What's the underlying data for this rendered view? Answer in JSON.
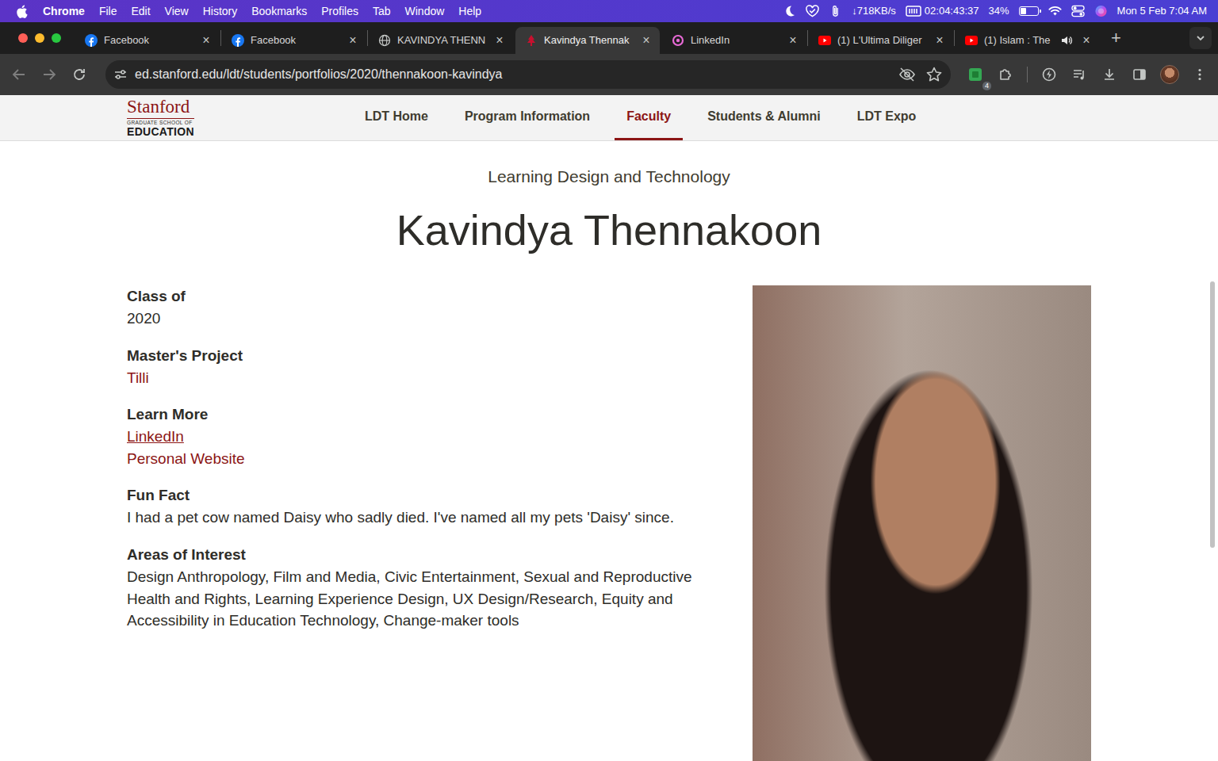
{
  "menu_bar": {
    "app": "Chrome",
    "menus": [
      "File",
      "Edit",
      "View",
      "History",
      "Bookmarks",
      "Profiles",
      "Tab",
      "Window",
      "Help"
    ],
    "network": "↓718KB/s",
    "timer": "02:04:43:37",
    "battery": {
      "reading": "34%",
      "level": 0.34
    },
    "clock": "Mon 5 Feb 7:04 AM"
  },
  "tabs": [
    {
      "label": "Facebook",
      "kind": "facebook",
      "selected": false,
      "audio": false,
      "close": "×"
    },
    {
      "label": "Facebook",
      "kind": "facebook",
      "selected": false,
      "audio": false,
      "close": "×"
    },
    {
      "label": "KAVINDYA THENN",
      "kind": "globe",
      "selected": false,
      "audio": false,
      "close": "×"
    },
    {
      "label": "Kavindya Thennak",
      "kind": "stanford",
      "selected": true,
      "audio": false,
      "close": "×"
    },
    {
      "label": "LinkedIn",
      "kind": "linkedin",
      "selected": false,
      "audio": false,
      "close": "×"
    },
    {
      "label": "(1) L'Ultima Diliger",
      "kind": "youtube",
      "selected": false,
      "audio": false,
      "close": "×"
    },
    {
      "label": "(1) Islam : The",
      "kind": "youtube",
      "selected": false,
      "audio": true,
      "close": "×"
    }
  ],
  "tab_strip": {
    "new_tab": "+"
  },
  "toolbar": {
    "nav_buttons": [
      {
        "kind": "back",
        "disabled": true
      },
      {
        "kind": "forward",
        "disabled": true
      },
      {
        "kind": "reload",
        "disabled": false
      }
    ],
    "url": "ed.stanford.edu/ldt/students/portfolios/2020/thennakoon-kavindya",
    "extension_badge": "4"
  },
  "site": {
    "logo": {
      "name": "Stanford",
      "line1": "GRADUATE SCHOOL OF",
      "line2": "EDUCATION"
    },
    "nav": [
      {
        "label": "LDT Home",
        "selected": false
      },
      {
        "label": "Program Information",
        "selected": false
      },
      {
        "label": "Faculty",
        "selected": true
      },
      {
        "label": "Students & Alumni",
        "selected": false
      },
      {
        "label": "LDT Expo",
        "selected": false
      }
    ]
  },
  "page": {
    "program": "Learning Design and Technology",
    "name": "Kavindya Thennakoon",
    "fields": [
      {
        "label": "Class of",
        "values": [
          {
            "kind": "text",
            "text": "2020"
          }
        ]
      },
      {
        "label": "Master's Project",
        "values": [
          {
            "kind": "link",
            "text": "Tilli",
            "underlined": false
          }
        ]
      },
      {
        "label": "Learn More",
        "values": [
          {
            "kind": "link",
            "text": "LinkedIn",
            "underlined": true
          },
          {
            "kind": "link",
            "text": "Personal Website",
            "underlined": false
          }
        ]
      },
      {
        "label": "Fun Fact",
        "values": [
          {
            "kind": "text",
            "text": "I had a pet cow named Daisy who sadly died. I've named all my pets 'Daisy' since."
          }
        ]
      },
      {
        "label": "Areas of Interest",
        "values": [
          {
            "kind": "text",
            "text": "Design Anthropology, Film and Media, Civic Entertainment, Sexual and Reproductive Health and Rights, Learning Experience Design, UX Design/Research, Equity and Accessibility in Education Technology, Change-maker tools"
          }
        ]
      }
    ]
  },
  "scrollbar": {
    "thumb_start": 0.28,
    "thumb_size": 0.4
  }
}
